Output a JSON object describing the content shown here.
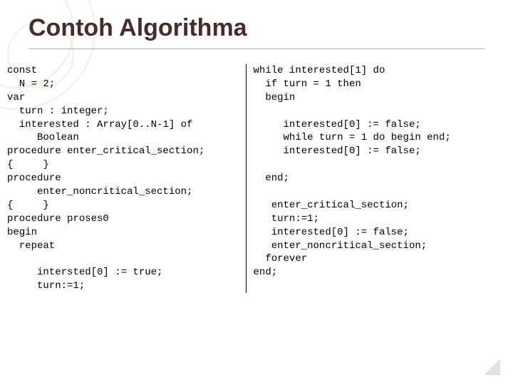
{
  "title": "Contoh Algorithma",
  "code_left": "const\n  N = 2;\nvar\n  turn : integer;\n  interested : Array[0..N-1] of\n     Boolean\nprocedure enter_critical_section;\n{     }\nprocedure\n     enter_noncritical_section;\n{     }\nprocedure proses0\nbegin\n  repeat\n\n     intersted[0] := true;\n     turn:=1;",
  "code_right": "while interested[1] do\n  if turn = 1 then\n  begin\n\n     interested[0] := false;\n     while turn = 1 do begin end;\n     interested[0] := false;\n\n  end;\n\n   enter_critical_section;\n   turn:=1;\n   interested[0] := false;\n   enter_noncritical_section;\n  forever\nend;"
}
